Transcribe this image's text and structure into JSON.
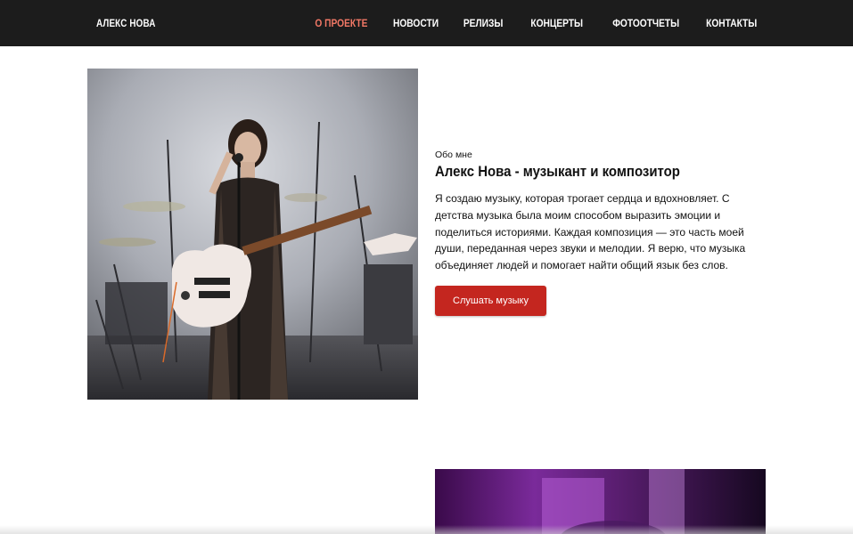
{
  "header": {
    "brand": "АЛЕКС НОВА",
    "nav": [
      {
        "label": "О ПРОЕКТЕ",
        "active": true
      },
      {
        "label": "НОВОСТИ",
        "active": false
      },
      {
        "label": "РЕЛИЗЫ",
        "active": false
      },
      {
        "label": "КОНЦЕРТЫ",
        "active": false
      },
      {
        "label": "ФОТООТЧЕТЫ",
        "active": false
      },
      {
        "label": "КОНТАКТЫ",
        "active": false
      }
    ]
  },
  "about": {
    "label": "Обо мне",
    "title": "Алекс Нова - музыкант и композитор",
    "text": "Я создаю музыку, которая трогает сердца и вдохновляет. С детства музыка была моим способом выразить эмоции и поделиться историями. Каждая композиция — это часть моей души, переданная через звуки и мелодии. Я верю, что музыка объединяет людей и помогает найти общий язык без слов.",
    "cta_label": "Слушать музыку"
  },
  "colors": {
    "header_bg": "#1c1c1c",
    "nav_active": "#f27866",
    "accent_button": "#c4261f"
  }
}
